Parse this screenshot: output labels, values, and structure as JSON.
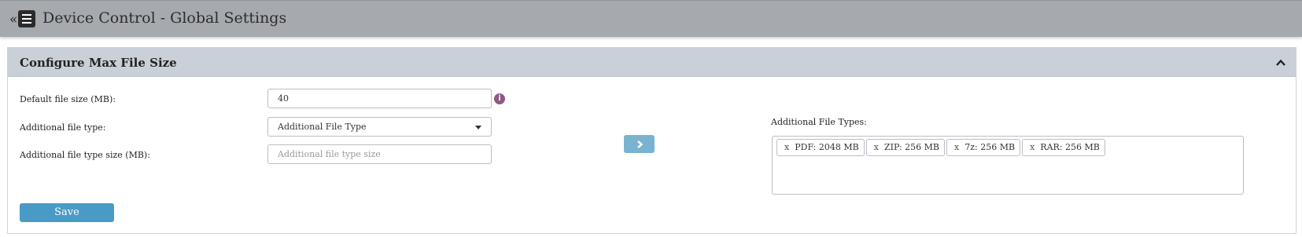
{
  "header": {
    "collapse_glyph": "«",
    "title": "Device Control - Global Settings"
  },
  "panel": {
    "title": "Configure Max File Size"
  },
  "form": {
    "default_size_label": "Default file size (MB):",
    "default_size_value": "40",
    "file_type_label": "Additional file type:",
    "file_type_selected": "Additional File Type",
    "file_type_size_label": "Additional file type size (MB):",
    "file_type_size_placeholder": "Additional file type size",
    "info_glyph": "i"
  },
  "file_types": {
    "label": "Additional File Types:",
    "remove_glyph": "x",
    "items": [
      {
        "label": "PDF: 2048 MB"
      },
      {
        "label": "ZIP: 256 MB"
      },
      {
        "label": "7z: 256 MB"
      },
      {
        "label": "RAR: 256 MB"
      }
    ]
  },
  "actions": {
    "save_label": "Save"
  },
  "icons": {
    "collapse": "double-chevron-left-icon",
    "menu": "hamburger-menu-icon",
    "panel_toggle": "chevron-up-icon",
    "info": "info-icon",
    "add": "chevron-right-icon",
    "dropdown": "caret-down-icon"
  },
  "colors": {
    "topbar": "#a6a9ae",
    "panel_header": "#c9d0d8",
    "save_button": "#4a9ac6",
    "add_button": "#79b3cf",
    "info_icon": "#8e5a86"
  }
}
